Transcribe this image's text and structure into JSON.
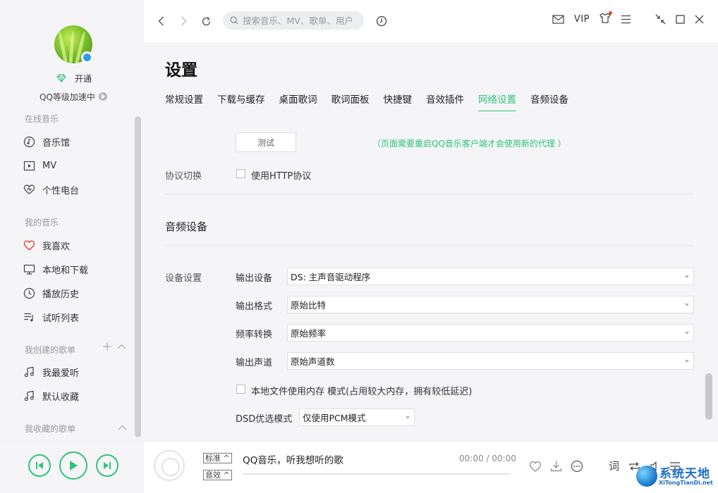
{
  "sidebar": {
    "vip_label": "开通",
    "level_label": "QQ等级加速中",
    "sections": {
      "online": "在线音乐",
      "mine": "我的音乐",
      "created": "我创建的歌单",
      "collected": "我收藏的歌单"
    },
    "online_items": [
      "音乐馆",
      "MV",
      "个性电台"
    ],
    "my_items": [
      "我喜欢",
      "本地和下载",
      "播放历史",
      "试听列表"
    ],
    "created_items": [
      "我最爱听",
      "默认收藏"
    ]
  },
  "topbar": {
    "search_placeholder": "搜索音乐、MV、歌单、用户",
    "vip": "VIP"
  },
  "settings": {
    "title": "设置",
    "tabs": [
      "常规设置",
      "下载与缓存",
      "桌面歌词",
      "歌词面板",
      "快捷键",
      "音效插件",
      "网络设置",
      "音频设备"
    ],
    "active_tab": "网络设置",
    "test_button": "测试",
    "proxy_note": "（页面需要重启QQ音乐客户端才会使用新的代理 ）",
    "protocol_label": "协议切换",
    "http_checkbox": "使用HTTP协议",
    "audio_section": "音频设备",
    "device_label": "设备设置",
    "fields": {
      "output_device": {
        "label": "输出设备",
        "value": "DS: 主声音驱动程序"
      },
      "output_format": {
        "label": "输出格式",
        "value": "原始比特"
      },
      "freq_convert": {
        "label": "频率转换",
        "value": "原始频率"
      },
      "output_channel": {
        "label": "输出声道",
        "value": "原始声道数"
      }
    },
    "memory_checkbox": "本地文件使用内存 模式(占用较大内存，拥有较低延迟)",
    "dsd_label": "DSD优选模式",
    "dsd_value": "仅使用PCM模式"
  },
  "player": {
    "quality_standard": "标准",
    "quality_effect": "音效",
    "song_title": "QQ音乐，听我想听的歌",
    "time": "00:00 / 00:00",
    "progress": 0,
    "lyric_button": "词"
  },
  "watermark": {
    "title": "系统天地",
    "url": "XiTongTianDi.net"
  },
  "colors": {
    "accent": "#31c27c",
    "panel": "#f5f5f7",
    "badge": "#2b9bf0",
    "heart": "#e8412e"
  }
}
